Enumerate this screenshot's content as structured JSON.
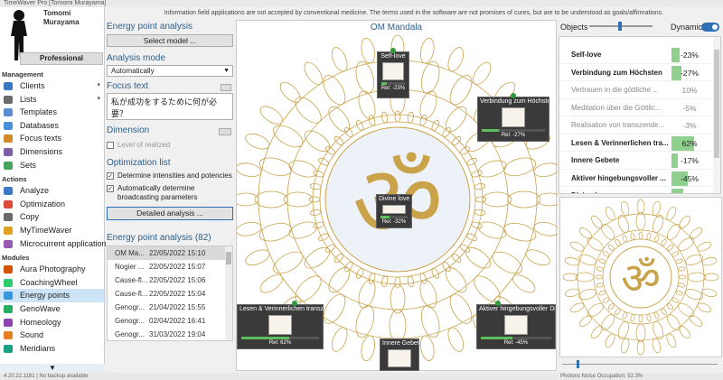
{
  "window": {
    "title": "TimeWaver Pro [Tomomi Murayama]"
  },
  "disclaimer": "Information field applications are not accepted by conventional medicine. The terms used in the software are not promises of cures, but are to be understood as goals/affirmations.",
  "profile": {
    "first": "Tomomi",
    "last": "Murayama",
    "edition": "Professional"
  },
  "sidebar": {
    "management_title": "Management",
    "management": [
      {
        "label": "Clients",
        "icon": "clients-icon",
        "arrow": true
      },
      {
        "label": "Lists",
        "icon": "lists-icon",
        "arrow": true
      },
      {
        "label": "Templates",
        "icon": "templates-icon"
      },
      {
        "label": "Databases",
        "icon": "databases-icon"
      },
      {
        "label": "Focus texts",
        "icon": "focus-texts-icon"
      },
      {
        "label": "Dimensions",
        "icon": "dimensions-icon"
      },
      {
        "label": "Sets",
        "icon": "sets-icon"
      }
    ],
    "actions_title": "Actions",
    "actions": [
      {
        "label": "Analyze",
        "icon": "analyze-icon"
      },
      {
        "label": "Optimization",
        "icon": "optimization-icon"
      },
      {
        "label": "Copy",
        "icon": "copy-icon"
      },
      {
        "label": "MyTimeWaver",
        "icon": "mytimewaver-icon"
      },
      {
        "label": "Microcurrent application",
        "icon": "microcurrent-icon"
      }
    ],
    "modules_title": "Modules",
    "modules": [
      {
        "label": "Aura Photography",
        "icon": "aura-icon"
      },
      {
        "label": "CoachingWheel",
        "icon": "coaching-wheel-icon"
      },
      {
        "label": "Energy points",
        "icon": "energy-points-icon",
        "active": true
      },
      {
        "label": "GenoWave",
        "icon": "genowave-icon"
      },
      {
        "label": "Homeology",
        "icon": "homeology-icon"
      },
      {
        "label": "Sound",
        "icon": "sound-icon"
      },
      {
        "label": "Meridians",
        "icon": "meridians-icon"
      }
    ]
  },
  "panel": {
    "energy_title": "Energy point analysis",
    "select_model": "Select model ...",
    "analysis_mode_title": "Analysis mode",
    "analysis_mode": "Automatically",
    "focus_title": "Focus text",
    "focus_text": "私が成功をするために何が必要？",
    "dimension_title": "Dimension",
    "dimension_placeholder": "Level of realized",
    "opt_title": "Optimization list",
    "opt_check1": "Determine intensities and potencies",
    "opt_check2": "Automatically determine broadcasting parameters",
    "detailed_btn": "Detailed analysis ...",
    "list_title": "Energy point analysis (82)",
    "rows": [
      {
        "name": "OM Ma...",
        "date": "22/05/2022 15:10"
      },
      {
        "name": "Nogier ...",
        "date": "22/05/2022 15:07"
      },
      {
        "name": "Cause-fl...",
        "date": "22/05/2022 15:06"
      },
      {
        "name": "Cause-fl...",
        "date": "22/05/2022 15:04"
      },
      {
        "name": "Genogr...",
        "date": "21/04/2022 15:55"
      },
      {
        "name": "Genogr...",
        "date": "02/04/2022 16:41"
      },
      {
        "name": "Genogr...",
        "date": "31/03/2022 19:04"
      }
    ]
  },
  "mandala": {
    "title": "OM Mandala",
    "nodes": [
      {
        "label": "Self-love",
        "rel": "Rel: -23%",
        "fill": 0.23
      },
      {
        "label": "Verbindung zum Höchsten",
        "rel": "Rel: -27%",
        "fill": 0.27
      },
      {
        "label": "Divine love",
        "rel": "Rel: -32%",
        "fill": 0.32
      },
      {
        "label": "Lesen & Verinnerlichen transzende...",
        "rel": "Rel: 62%",
        "fill": 0.62
      },
      {
        "label": "Aktiver hingebungsvoller Dien",
        "rel": "Rel: -45%",
        "fill": 0.45
      },
      {
        "label": "Innere Gebete",
        "rel": "",
        "fill": 0.17
      }
    ]
  },
  "right": {
    "objects_label": "Objects",
    "dynamic_label": "Dynamic",
    "items": [
      {
        "label": "Self-love",
        "value": "-23%",
        "fill": 0.23,
        "style": "bold"
      },
      {
        "label": "Verbindung zum Höchsten",
        "value": "-27%",
        "fill": 0.27,
        "style": "bold"
      },
      {
        "label": "Vertrauen in die göttliche ...",
        "value": "10%",
        "fill": 0,
        "style": "grey"
      },
      {
        "label": "Meditation über die Göttlic...",
        "value": "-5%",
        "fill": 0,
        "style": "grey"
      },
      {
        "label": "Realisation von transzende...",
        "value": "-3%",
        "fill": 0,
        "style": "grey"
      },
      {
        "label": "Lesen & Verinnerlichen tra...",
        "value": "62%",
        "fill": 0.62,
        "style": "bold"
      },
      {
        "label": "Innere Gebete",
        "value": "-17%",
        "fill": 0.17,
        "style": "bold"
      },
      {
        "label": "Aktiver hingebungsvoller ...",
        "value": "-45%",
        "fill": 0.45,
        "style": "bold"
      },
      {
        "label": "Divine love",
        "value": "-32%",
        "fill": 0.32,
        "style": "bold"
      }
    ]
  },
  "status": {
    "left": "4.20.22.1181 | No backup available",
    "right": "Photons  Noise  Occupation: 52.3%"
  },
  "colors": {
    "accent": "#2f6fb3",
    "gold": "#c9a24a",
    "bar": "#8fd08f"
  }
}
